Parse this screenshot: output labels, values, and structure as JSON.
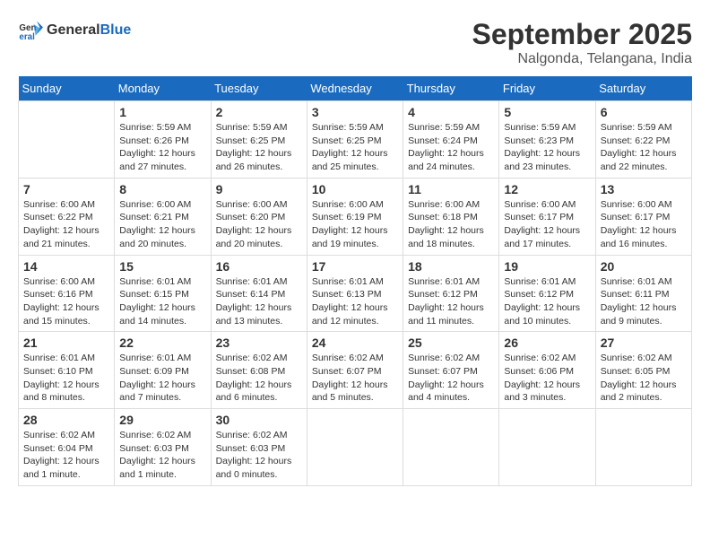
{
  "logo": {
    "text_general": "General",
    "text_blue": "Blue"
  },
  "header": {
    "month_title": "September 2025",
    "subtitle": "Nalgonda, Telangana, India"
  },
  "days_of_week": [
    "Sunday",
    "Monday",
    "Tuesday",
    "Wednesday",
    "Thursday",
    "Friday",
    "Saturday"
  ],
  "weeks": [
    [
      {
        "day": "",
        "sunrise": "",
        "sunset": "",
        "daylight": "",
        "empty": true
      },
      {
        "day": "1",
        "sunrise": "Sunrise: 5:59 AM",
        "sunset": "Sunset: 6:26 PM",
        "daylight": "Daylight: 12 hours and 27 minutes."
      },
      {
        "day": "2",
        "sunrise": "Sunrise: 5:59 AM",
        "sunset": "Sunset: 6:25 PM",
        "daylight": "Daylight: 12 hours and 26 minutes."
      },
      {
        "day": "3",
        "sunrise": "Sunrise: 5:59 AM",
        "sunset": "Sunset: 6:25 PM",
        "daylight": "Daylight: 12 hours and 25 minutes."
      },
      {
        "day": "4",
        "sunrise": "Sunrise: 5:59 AM",
        "sunset": "Sunset: 6:24 PM",
        "daylight": "Daylight: 12 hours and 24 minutes."
      },
      {
        "day": "5",
        "sunrise": "Sunrise: 5:59 AM",
        "sunset": "Sunset: 6:23 PM",
        "daylight": "Daylight: 12 hours and 23 minutes."
      },
      {
        "day": "6",
        "sunrise": "Sunrise: 5:59 AM",
        "sunset": "Sunset: 6:22 PM",
        "daylight": "Daylight: 12 hours and 22 minutes."
      }
    ],
    [
      {
        "day": "7",
        "sunrise": "Sunrise: 6:00 AM",
        "sunset": "Sunset: 6:22 PM",
        "daylight": "Daylight: 12 hours and 21 minutes."
      },
      {
        "day": "8",
        "sunrise": "Sunrise: 6:00 AM",
        "sunset": "Sunset: 6:21 PM",
        "daylight": "Daylight: 12 hours and 20 minutes."
      },
      {
        "day": "9",
        "sunrise": "Sunrise: 6:00 AM",
        "sunset": "Sunset: 6:20 PM",
        "daylight": "Daylight: 12 hours and 20 minutes."
      },
      {
        "day": "10",
        "sunrise": "Sunrise: 6:00 AM",
        "sunset": "Sunset: 6:19 PM",
        "daylight": "Daylight: 12 hours and 19 minutes."
      },
      {
        "day": "11",
        "sunrise": "Sunrise: 6:00 AM",
        "sunset": "Sunset: 6:18 PM",
        "daylight": "Daylight: 12 hours and 18 minutes."
      },
      {
        "day": "12",
        "sunrise": "Sunrise: 6:00 AM",
        "sunset": "Sunset: 6:17 PM",
        "daylight": "Daylight: 12 hours and 17 minutes."
      },
      {
        "day": "13",
        "sunrise": "Sunrise: 6:00 AM",
        "sunset": "Sunset: 6:17 PM",
        "daylight": "Daylight: 12 hours and 16 minutes."
      }
    ],
    [
      {
        "day": "14",
        "sunrise": "Sunrise: 6:00 AM",
        "sunset": "Sunset: 6:16 PM",
        "daylight": "Daylight: 12 hours and 15 minutes."
      },
      {
        "day": "15",
        "sunrise": "Sunrise: 6:01 AM",
        "sunset": "Sunset: 6:15 PM",
        "daylight": "Daylight: 12 hours and 14 minutes."
      },
      {
        "day": "16",
        "sunrise": "Sunrise: 6:01 AM",
        "sunset": "Sunset: 6:14 PM",
        "daylight": "Daylight: 12 hours and 13 minutes."
      },
      {
        "day": "17",
        "sunrise": "Sunrise: 6:01 AM",
        "sunset": "Sunset: 6:13 PM",
        "daylight": "Daylight: 12 hours and 12 minutes."
      },
      {
        "day": "18",
        "sunrise": "Sunrise: 6:01 AM",
        "sunset": "Sunset: 6:12 PM",
        "daylight": "Daylight: 12 hours and 11 minutes."
      },
      {
        "day": "19",
        "sunrise": "Sunrise: 6:01 AM",
        "sunset": "Sunset: 6:12 PM",
        "daylight": "Daylight: 12 hours and 10 minutes."
      },
      {
        "day": "20",
        "sunrise": "Sunrise: 6:01 AM",
        "sunset": "Sunset: 6:11 PM",
        "daylight": "Daylight: 12 hours and 9 minutes."
      }
    ],
    [
      {
        "day": "21",
        "sunrise": "Sunrise: 6:01 AM",
        "sunset": "Sunset: 6:10 PM",
        "daylight": "Daylight: 12 hours and 8 minutes."
      },
      {
        "day": "22",
        "sunrise": "Sunrise: 6:01 AM",
        "sunset": "Sunset: 6:09 PM",
        "daylight": "Daylight: 12 hours and 7 minutes."
      },
      {
        "day": "23",
        "sunrise": "Sunrise: 6:02 AM",
        "sunset": "Sunset: 6:08 PM",
        "daylight": "Daylight: 12 hours and 6 minutes."
      },
      {
        "day": "24",
        "sunrise": "Sunrise: 6:02 AM",
        "sunset": "Sunset: 6:07 PM",
        "daylight": "Daylight: 12 hours and 5 minutes."
      },
      {
        "day": "25",
        "sunrise": "Sunrise: 6:02 AM",
        "sunset": "Sunset: 6:07 PM",
        "daylight": "Daylight: 12 hours and 4 minutes."
      },
      {
        "day": "26",
        "sunrise": "Sunrise: 6:02 AM",
        "sunset": "Sunset: 6:06 PM",
        "daylight": "Daylight: 12 hours and 3 minutes."
      },
      {
        "day": "27",
        "sunrise": "Sunrise: 6:02 AM",
        "sunset": "Sunset: 6:05 PM",
        "daylight": "Daylight: 12 hours and 2 minutes."
      }
    ],
    [
      {
        "day": "28",
        "sunrise": "Sunrise: 6:02 AM",
        "sunset": "Sunset: 6:04 PM",
        "daylight": "Daylight: 12 hours and 1 minute."
      },
      {
        "day": "29",
        "sunrise": "Sunrise: 6:02 AM",
        "sunset": "Sunset: 6:03 PM",
        "daylight": "Daylight: 12 hours and 1 minute."
      },
      {
        "day": "30",
        "sunrise": "Sunrise: 6:02 AM",
        "sunset": "Sunset: 6:03 PM",
        "daylight": "Daylight: 12 hours and 0 minutes."
      },
      {
        "day": "",
        "sunrise": "",
        "sunset": "",
        "daylight": "",
        "empty": true
      },
      {
        "day": "",
        "sunrise": "",
        "sunset": "",
        "daylight": "",
        "empty": true
      },
      {
        "day": "",
        "sunrise": "",
        "sunset": "",
        "daylight": "",
        "empty": true
      },
      {
        "day": "",
        "sunrise": "",
        "sunset": "",
        "daylight": "",
        "empty": true
      }
    ]
  ]
}
